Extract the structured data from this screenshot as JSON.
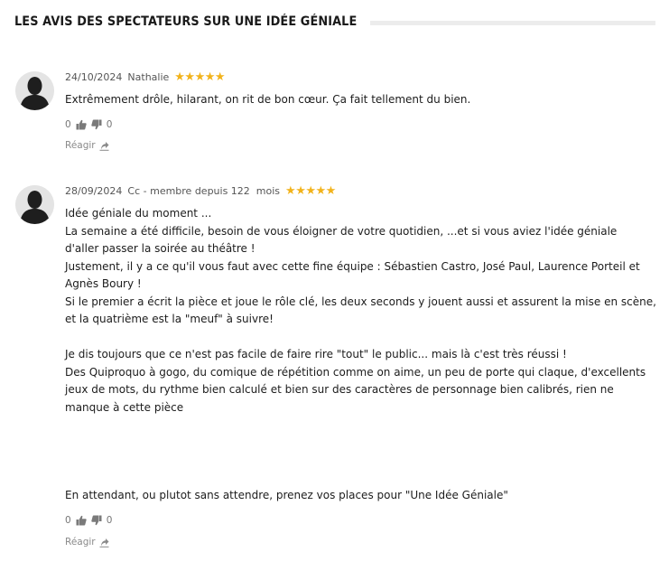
{
  "section_title": "LES AVIS DES SPECTATEURS SUR UNE IDÉE GÉNIALE",
  "reviews": [
    {
      "date": "24/10/2024",
      "author": "Nathalie",
      "rating": 5,
      "stars": "★★★★★",
      "lines": [
        "Extrêmement drôle, hilarant, on rit de bon cœur. Ça fait tellement du bien."
      ],
      "likes": "0",
      "dislikes": "0",
      "react_label": "Réagir"
    },
    {
      "date": "28/09/2024",
      "author": "Cc - membre depuis 122  mois",
      "rating": 5,
      "stars": "★★★★★",
      "lines": [
        "Idée géniale du moment ...",
        "La semaine a été difficile, besoin de vous éloigner de votre quotidien, ...et si vous aviez l'idée géniale d'aller passer la soirée au théâtre !",
        "Justement, il y a ce qu'il vous faut avec cette fine équipe : Sébastien Castro, José Paul, Laurence Porteil et Agnès Boury !",
        "Si le premier a écrit la pièce et joue le rôle clé, les deux seconds y jouent aussi et assurent la mise en scène, et la quatrième est la \"meuf\" à suivre!",
        "Je dis toujours que ce n'est pas facile de faire rire \"tout\" le public... mais là c'est très réussi !",
        "Des Quiproquo à gogo, du comique de répétition comme on aime, un peu de porte qui claque, d'excellents jeux de mots, du rythme bien calculé et bien sur des caractères de personnage bien calibrés, rien ne manque à cette pièce",
        "En attendant, ou plutot sans attendre, prenez vos places pour \"Une Idée Géniale\""
      ],
      "likes": "0",
      "dislikes": "0",
      "react_label": "Réagir"
    }
  ],
  "icons": {
    "avatar": "user-silhouette-icon",
    "like": "thumbs-up-icon",
    "dislike": "thumbs-down-icon",
    "react": "reply-arrow-icon"
  },
  "colors": {
    "star": "#f2b31b",
    "heading": "#1a1a1a",
    "muted": "#777777"
  }
}
